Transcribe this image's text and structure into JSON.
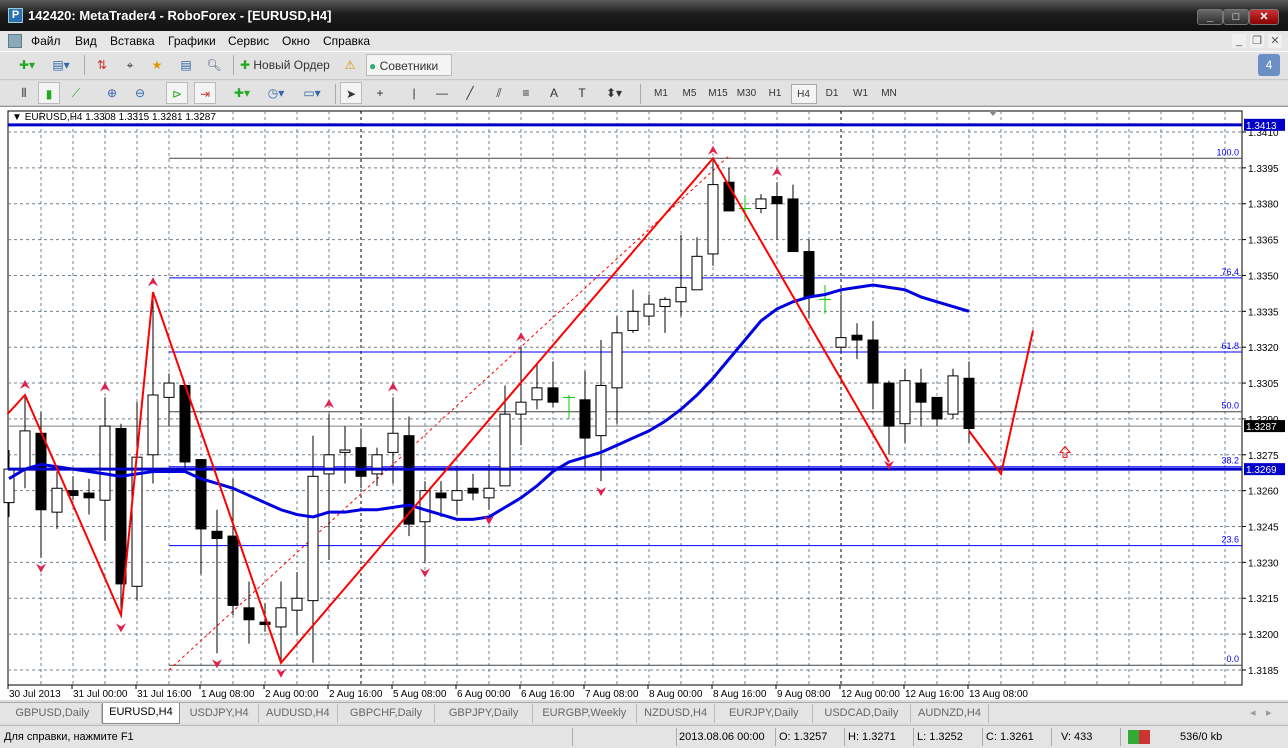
{
  "window": {
    "title": "142420: MetaTrader4 - RoboForex - [EURUSD,H4]",
    "icon": "P",
    "minimize": "_",
    "maximize": "□",
    "close": "✕"
  },
  "menu": [
    "Файл",
    "Вид",
    "Вставка",
    "Графики",
    "Сервис",
    "Окно",
    "Справка"
  ],
  "toolbar": {
    "new_order": "Новый Ордер",
    "experts": "Советники",
    "notifications_count": "4"
  },
  "timeframes": [
    "M1",
    "M5",
    "M15",
    "M30",
    "H1",
    "H4",
    "D1",
    "W1",
    "MN"
  ],
  "active_timeframe": "H4",
  "chart_header": "EURUSD,H4  1.3308 1.3315 1.3281 1.3287",
  "colors": {
    "bull": "#ffffff",
    "bear": "#000000",
    "ma": "#0000e0",
    "zigzag": "#ff0000",
    "fibo": "#0000ff",
    "fractal": "#e0204a",
    "grid": "#708090"
  },
  "chart_data": {
    "type": "candlestick",
    "symbol": "EURUSD",
    "timeframe": "H4",
    "ylim": [
      1.3178,
      1.3418
    ],
    "price_ticks": [
      1.341,
      1.3395,
      1.338,
      1.3365,
      1.335,
      1.3335,
      1.332,
      1.3305,
      1.329,
      1.3275,
      1.326,
      1.3245,
      1.323,
      1.3215,
      1.32,
      1.3185
    ],
    "time_labels": [
      "30 Jul 2013",
      "31 Jul 00:00",
      "31 Jul 16:00",
      "1 Aug 08:00",
      "2 Aug 00:00",
      "2 Aug 16:00",
      "5 Aug 08:00",
      "6 Aug 00:00",
      "6 Aug 16:00",
      "7 Aug 08:00",
      "8 Aug 00:00",
      "8 Aug 16:00",
      "9 Aug 08:00",
      "12 Aug 00:00",
      "12 Aug 16:00",
      "13 Aug 08:00"
    ],
    "ohlc": [
      [
        1.3255,
        1.3277,
        1.3249,
        1.3269
      ],
      [
        1.3269,
        1.33,
        1.3261,
        1.3285
      ],
      [
        1.3284,
        1.3293,
        1.3232,
        1.3252
      ],
      [
        1.3251,
        1.3268,
        1.3244,
        1.3261
      ],
      [
        1.326,
        1.3266,
        1.3256,
        1.3258
      ],
      [
        1.3259,
        1.3265,
        1.325,
        1.3257
      ],
      [
        1.3256,
        1.3299,
        1.3239,
        1.3287
      ],
      [
        1.3286,
        1.3288,
        1.3207,
        1.3221
      ],
      [
        1.322,
        1.3297,
        1.3214,
        1.3274
      ],
      [
        1.3275,
        1.3343,
        1.3263,
        1.33
      ],
      [
        1.3299,
        1.3309,
        1.3287,
        1.3305
      ],
      [
        1.3304,
        1.3304,
        1.3268,
        1.3272
      ],
      [
        1.3273,
        1.3273,
        1.3225,
        1.3244
      ],
      [
        1.3243,
        1.3252,
        1.3192,
        1.324
      ],
      [
        1.3241,
        1.3265,
        1.3208,
        1.3212
      ],
      [
        1.3211,
        1.3222,
        1.3196,
        1.3206
      ],
      [
        1.3205,
        1.3213,
        1.3201,
        1.3204
      ],
      [
        1.3203,
        1.3222,
        1.3188,
        1.3211
      ],
      [
        1.321,
        1.3226,
        1.32,
        1.3215
      ],
      [
        1.3214,
        1.3283,
        1.3188,
        1.3266
      ],
      [
        1.3267,
        1.3292,
        1.3231,
        1.3275
      ],
      [
        1.3276,
        1.3287,
        1.3263,
        1.3277
      ],
      [
        1.3278,
        1.3286,
        1.3261,
        1.3266
      ],
      [
        1.3267,
        1.3278,
        1.3262,
        1.3275
      ],
      [
        1.3276,
        1.3299,
        1.3263,
        1.3284
      ],
      [
        1.3283,
        1.3291,
        1.3241,
        1.3246
      ],
      [
        1.3247,
        1.3264,
        1.323,
        1.326
      ],
      [
        1.3259,
        1.3264,
        1.3249,
        1.3257
      ],
      [
        1.3256,
        1.327,
        1.325,
        1.326
      ],
      [
        1.3261,
        1.3267,
        1.3256,
        1.3259
      ],
      [
        1.3257,
        1.3271,
        1.3252,
        1.3261
      ],
      [
        1.3262,
        1.3304,
        1.3262,
        1.3292
      ],
      [
        1.3292,
        1.332,
        1.3279,
        1.3297
      ],
      [
        1.3298,
        1.3313,
        1.3294,
        1.3303
      ],
      [
        1.3303,
        1.3314,
        1.3295,
        1.3297
      ],
      [
        1.3299,
        1.33,
        1.329,
        1.3299
      ],
      [
        1.3298,
        1.331,
        1.327,
        1.3282
      ],
      [
        1.3283,
        1.3323,
        1.3264,
        1.3304
      ],
      [
        1.3303,
        1.3333,
        1.3288,
        1.3326
      ],
      [
        1.3327,
        1.3344,
        1.3326,
        1.3335
      ],
      [
        1.3333,
        1.3342,
        1.3329,
        1.3338
      ],
      [
        1.3337,
        1.3341,
        1.3326,
        1.334
      ],
      [
        1.3339,
        1.3367,
        1.3333,
        1.3345
      ],
      [
        1.3344,
        1.3366,
        1.3344,
        1.3358
      ],
      [
        1.3359,
        1.3398,
        1.3354,
        1.3388
      ],
      [
        1.3389,
        1.3395,
        1.3377,
        1.3377
      ],
      [
        1.3378,
        1.3383,
        1.3373,
        1.3378
      ],
      [
        1.3378,
        1.3384,
        1.3376,
        1.3382
      ],
      [
        1.3383,
        1.3389,
        1.3365,
        1.338
      ],
      [
        1.3382,
        1.3388,
        1.336,
        1.336
      ],
      [
        1.336,
        1.3365,
        1.3332,
        1.3341
      ],
      [
        1.334,
        1.3346,
        1.3334,
        1.334
      ],
      [
        1.332,
        1.3342,
        1.3318,
        1.3324
      ],
      [
        1.3325,
        1.333,
        1.3315,
        1.3323
      ],
      [
        1.3323,
        1.3331,
        1.3294,
        1.3305
      ],
      [
        1.3305,
        1.3306,
        1.3275,
        1.3287
      ],
      [
        1.3288,
        1.3311,
        1.328,
        1.3306
      ],
      [
        1.3305,
        1.3311,
        1.3287,
        1.3297
      ],
      [
        1.3299,
        1.3299,
        1.3287,
        1.329
      ],
      [
        1.3292,
        1.3311,
        1.329,
        1.3308
      ],
      [
        1.3307,
        1.3314,
        1.328,
        1.3286
      ]
    ],
    "moving_average": [
      1.3265,
      1.3269,
      1.3271,
      1.327,
      1.3269,
      1.3268,
      1.3267,
      1.3266,
      1.3267,
      1.3268,
      1.3268,
      1.3268,
      1.3265,
      1.3263,
      1.3261,
      1.3258,
      1.3255,
      1.3252,
      1.325,
      1.3249,
      1.3251,
      1.3251,
      1.3252,
      1.3252,
      1.3253,
      1.3254,
      1.3252,
      1.325,
      1.3248,
      1.3248,
      1.3249,
      1.3253,
      1.3257,
      1.3262,
      1.3268,
      1.3272,
      1.3274,
      1.3276,
      1.3279,
      1.3282,
      1.3285,
      1.3289,
      1.3294,
      1.33,
      1.3307,
      1.3315,
      1.3323,
      1.3331,
      1.3336,
      1.3339,
      1.3341,
      1.3342,
      1.3344,
      1.3345,
      1.3346,
      1.3345,
      1.3344,
      1.3341,
      1.3339,
      1.3337,
      1.3335
    ],
    "zigzag": [
      [
        [
          -0.1,
          1.3292
        ],
        [
          1,
          1.33
        ],
        [
          7,
          1.3208
        ],
        [
          9,
          1.3343
        ],
        [
          17,
          1.3188
        ],
        [
          44,
          1.3399
        ],
        [
          55,
          1.3272
        ]
      ],
      [
        [
          60,
          1.3285
        ],
        [
          62,
          1.3267
        ],
        [
          64,
          1.3327
        ]
      ]
    ],
    "fractals_up": [
      1,
      6,
      9,
      20,
      24,
      32,
      44,
      48
    ],
    "fractals_down": [
      2,
      7,
      13,
      17,
      26,
      30,
      37,
      55
    ],
    "fibonacci": {
      "start_bar": 10,
      "low": 1.3187,
      "high": 1.3399,
      "levels": [
        {
          "label": "0.0",
          "value": 1.3187
        },
        {
          "label": "23.6",
          "value": 1.3237
        },
        {
          "label": "38.2",
          "value": 1.327
        },
        {
          "label": "50.0",
          "value": 1.3293
        },
        {
          "label": "61.8",
          "value": 1.3318
        },
        {
          "label": "76.4",
          "value": 1.3349
        },
        {
          "label": "100.0",
          "value": 1.3399
        }
      ]
    },
    "fib_trendline": [
      [
        10,
        1.3185
      ],
      [
        45,
        1.34
      ]
    ],
    "hlines": [
      {
        "label": "1.3413",
        "value": 1.3413
      },
      {
        "label": "1.3269",
        "value": 1.3269
      }
    ],
    "bid": {
      "label": "1.3287",
      "value": 1.3287
    },
    "period_separators": [
      22,
      52
    ],
    "arrow_object": {
      "bar": 66,
      "price": 1.3276
    }
  },
  "tabs": [
    "GBPUSD,Daily",
    "EURUSD,H4",
    "USDJPY,H4",
    "AUDUSD,H4",
    "GBPCHF,Daily",
    "GBPJPY,Daily",
    "EURGBP,Weekly",
    "NZDUSD,H4",
    "EURJPY,Daily",
    "USDCAD,Daily",
    "AUDNZD,H4"
  ],
  "active_tab": "EURUSD,H4",
  "status": {
    "help": "Для справки, нажмите F1",
    "time": "2013.08.06 00:00",
    "open": "O: 1.3257",
    "high": "H: 1.3271",
    "low": "L: 1.3252",
    "close": "C: 1.3261",
    "volume": "V: 433",
    "traffic": "536/0 kb"
  }
}
